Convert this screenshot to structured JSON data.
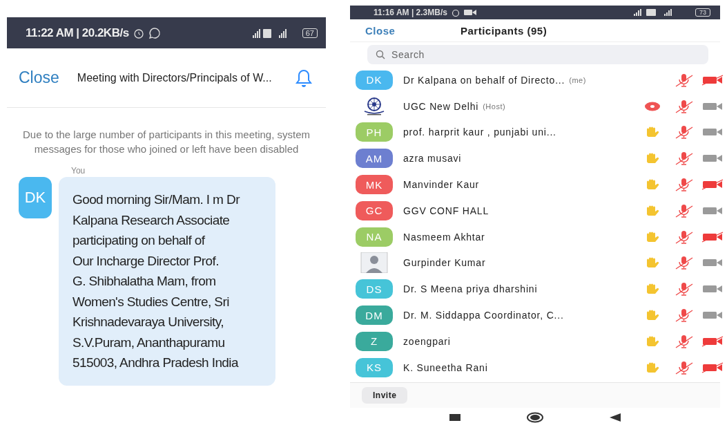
{
  "chat_screen": {
    "status_bar": {
      "time_speed": "11:22 AM | 20.2KB/s",
      "battery": "67"
    },
    "header": {
      "close": "Close",
      "title": "Meeting with Directors/Principals of W..."
    },
    "system_message": "Due to the large number of participants in this meeting, system messages for those who joined or left have been disabled",
    "message": {
      "sender": "You",
      "initials": "DK",
      "color": "#4ab8ef",
      "text": "Good morning Sir/Mam. I m Dr\nKalpana Research Associate\nparticipating on behalf of\nOur Incharge Director Prof.\nG. Shibhalatha Mam, from\nWomen's Studies Centre, Sri\nKrishnadevaraya University,\nS.V.Puram, Ananthapuramu\n515003, Andhra Pradesh India"
    }
  },
  "participants_screen": {
    "status_bar": {
      "time_speed": "11:16 AM | 2.3MB/s",
      "battery": "73"
    },
    "header": {
      "close": "Close",
      "title": "Participants (95)"
    },
    "search": {
      "placeholder": "Search"
    },
    "participants": [
      {
        "kind": "initials",
        "initials": "DK",
        "color": "#4ab8ef",
        "name": "Dr Kalpana on behalf of Directo...",
        "tag": "(me)",
        "recording": false,
        "hand_raised": false,
        "video_stopped": true
      },
      {
        "kind": "logo",
        "name": "UGC New Delhi",
        "tag": "(Host)",
        "recording": true,
        "hand_raised": false,
        "video_stopped": false
      },
      {
        "kind": "initials",
        "initials": "PH",
        "color": "#9ccc65",
        "name": "prof. harprit kaur ,  punjabi uni...",
        "recording": false,
        "hand_raised": true,
        "video_stopped": false
      },
      {
        "kind": "initials",
        "initials": "AM",
        "color": "#6d7fd0",
        "name": "azra musavi",
        "recording": false,
        "hand_raised": true,
        "video_stopped": false
      },
      {
        "kind": "initials",
        "initials": "MK",
        "color": "#ef5b5b",
        "name": "Manvinder Kaur",
        "recording": false,
        "hand_raised": true,
        "video_stopped": true
      },
      {
        "kind": "initials",
        "initials": "GC",
        "color": "#ef5b5b",
        "name": "GGV CONF HALL",
        "recording": false,
        "hand_raised": true,
        "video_stopped": false
      },
      {
        "kind": "initials",
        "initials": "NA",
        "color": "#9ccc65",
        "name": "Nasmeem Akhtar",
        "recording": false,
        "hand_raised": true,
        "video_stopped": true
      },
      {
        "kind": "photo",
        "name": "Gurpinder Kumar",
        "recording": false,
        "hand_raised": true,
        "video_stopped": false
      },
      {
        "kind": "initials",
        "initials": "DS",
        "color": "#46c4d8",
        "name": "Dr. S Meena priya dharshini",
        "recording": false,
        "hand_raised": true,
        "video_stopped": false
      },
      {
        "kind": "initials",
        "initials": "DM",
        "color": "#3aaa9c",
        "name": "Dr. M. Siddappa Coordinator, C...",
        "recording": false,
        "hand_raised": true,
        "video_stopped": false
      },
      {
        "kind": "initials",
        "initials": "Z",
        "color": "#3aaa9c",
        "name": "zoengpari",
        "recording": false,
        "hand_raised": true,
        "video_stopped": true
      },
      {
        "kind": "initials",
        "initials": "KS",
        "color": "#46c4d8",
        "name": "K. Suneetha Rani",
        "recording": false,
        "hand_raised": true,
        "video_stopped": true
      }
    ],
    "invite": "Invite"
  }
}
